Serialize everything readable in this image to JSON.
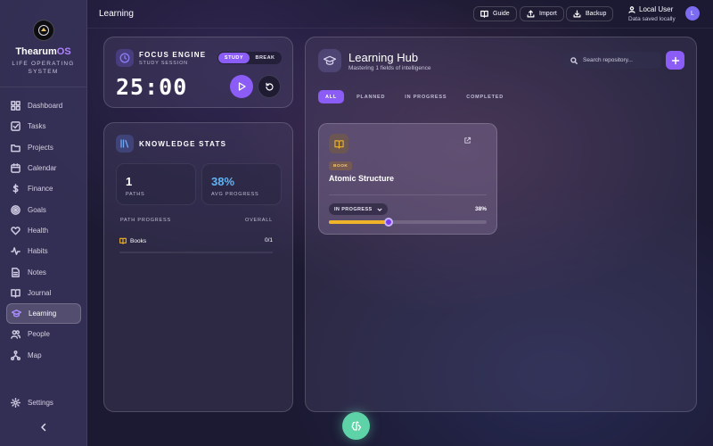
{
  "brand": {
    "name_main": "Thearum",
    "name_accent": "OS",
    "subtitle": "LIFE OPERATING SYSTEM",
    "accent": "#b184ff"
  },
  "sidebar": {
    "items": [
      {
        "label": "Dashboard",
        "icon": "grid-icon"
      },
      {
        "label": "Tasks",
        "icon": "check-square-icon"
      },
      {
        "label": "Projects",
        "icon": "folder-icon"
      },
      {
        "label": "Calendar",
        "icon": "calendar-icon"
      },
      {
        "label": "Finance",
        "icon": "dollar-icon"
      },
      {
        "label": "Goals",
        "icon": "target-icon"
      },
      {
        "label": "Health",
        "icon": "heart-icon"
      },
      {
        "label": "Habits",
        "icon": "activity-icon"
      },
      {
        "label": "Notes",
        "icon": "file-text-icon"
      },
      {
        "label": "Journal",
        "icon": "book-open-icon"
      },
      {
        "label": "Learning",
        "icon": "graduation-cap-icon",
        "active": true
      },
      {
        "label": "People",
        "icon": "users-icon"
      },
      {
        "label": "Map",
        "icon": "network-icon"
      }
    ],
    "settings_label": "Settings"
  },
  "topbar": {
    "title": "Learning",
    "guide_label": "Guide",
    "import_label": "Import",
    "backup_label": "Backup",
    "user_name": "Local User",
    "user_status": "Data saved locally",
    "avatar_initial": "L"
  },
  "focus": {
    "title": "FOCUS ENGINE",
    "subtitle": "STUDY SESSION",
    "mode_study": "STUDY",
    "mode_break": "BREAK",
    "timer": "25:00"
  },
  "stats": {
    "title": "KNOWLEDGE STATS",
    "paths_value": "1",
    "paths_label": "PATHS",
    "avg_value": "38%",
    "avg_label": "AVG PROGRESS",
    "progress_header": "PATH PROGRESS",
    "overall_header": "OVERALL",
    "rows": [
      {
        "label": "Books",
        "count": "0/1"
      }
    ]
  },
  "hub": {
    "title": "Learning Hub",
    "subtitle": "Mastering 1 fields of intelligence",
    "search_placeholder": "Search repository...",
    "filters": [
      "ALL",
      "PLANNED",
      "IN PROGRESS",
      "COMPLETED"
    ],
    "active_filter": "ALL",
    "items": [
      {
        "badge": "BOOK",
        "title": "Atomic Structure",
        "status": "IN PROGRESS",
        "progress_label": "38%",
        "progress": 0.38
      }
    ]
  },
  "colors": {
    "primary": "#8b5cf6",
    "progress": "#f0b429",
    "stat_blue": "#60b4f5",
    "fab": "#5ed3a8"
  }
}
